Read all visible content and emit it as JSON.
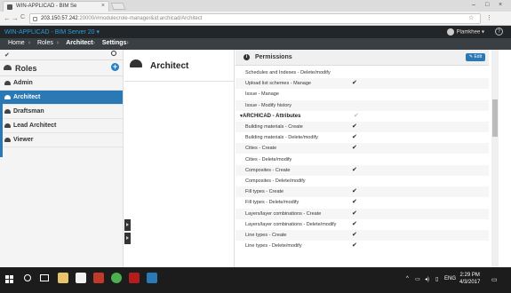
{
  "browser": {
    "tab_title": "WIN-APPLICAD - BIM Se",
    "tab_close": "×",
    "url_ip": "203.150.57.242",
    "url_path": ":20000/#modulecrole-manager&id:archicad/Architect",
    "nav_back": "←",
    "nav_forward": "→",
    "nav_reload": "C",
    "win_minimize": "–",
    "win_maximize": "□",
    "win_close": "×"
  },
  "app": {
    "title": "WIN-APPLICAD - BIM Server 20 ▾",
    "user": "Plamkhee ▾",
    "help": "?"
  },
  "breadcrumb": {
    "items": [
      "Home",
      "Roles",
      "Architect",
      "Settings"
    ]
  },
  "roles_panel": {
    "check": "✔",
    "title": "Roles",
    "add": "+",
    "items": [
      "Admin",
      "Architect",
      "Draftsman",
      "Lead Architect",
      "Viewer"
    ],
    "selected": "Architect"
  },
  "detail": {
    "title": "Architect"
  },
  "permissions": {
    "title": "Permissions",
    "edit_label": "✎ Edit",
    "rows": [
      {
        "label": "Schedules and Indexes - Delete/modify",
        "check": ""
      },
      {
        "label": "Upload list schemes - Manage",
        "check": "✔"
      },
      {
        "label": "Issue - Manage",
        "check": ""
      },
      {
        "label": "Issue - Modify history",
        "check": ""
      },
      {
        "label": "ARCHICAD - Attributes",
        "check": "✔",
        "section": true
      },
      {
        "label": "Building materials - Create",
        "check": "✔"
      },
      {
        "label": "Building materials - Delete/modify",
        "check": "✔"
      },
      {
        "label": "Cities - Create",
        "check": "✔"
      },
      {
        "label": "Cities - Delete/modify",
        "check": ""
      },
      {
        "label": "Composites - Create",
        "check": "✔"
      },
      {
        "label": "Composites - Delete/modify",
        "check": ""
      },
      {
        "label": "Fill types - Create",
        "check": "✔"
      },
      {
        "label": "Fill types - Delete/modify",
        "check": "✔"
      },
      {
        "label": "Layers/layer combinations - Create",
        "check": "✔"
      },
      {
        "label": "Layers/layer combinations - Delete/modify",
        "check": "✔"
      },
      {
        "label": "Line types - Create",
        "check": "✔"
      },
      {
        "label": "Line types - Delete/modify",
        "check": "✔"
      }
    ]
  },
  "taskbar": {
    "lang": "ENG",
    "time": "2:29 PM",
    "date": "4/3/2017"
  },
  "colors": {
    "accent": "#2a79b5",
    "header_bg": "#232629",
    "breadcrumb_bg": "#3a3f44",
    "taskbar_bg": "#1c1c1c"
  }
}
